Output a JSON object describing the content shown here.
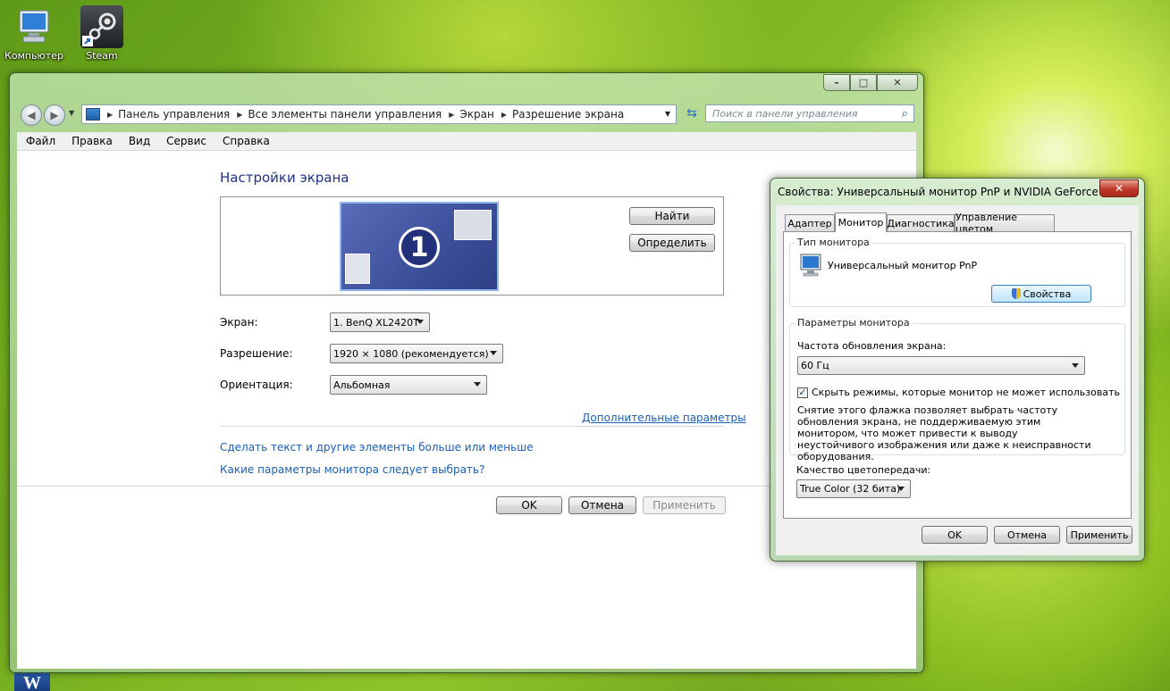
{
  "desktop": {
    "icons": [
      {
        "label": "Компьютер"
      },
      {
        "label": "Steam"
      }
    ]
  },
  "main_window": {
    "address_crumbs": [
      "Панель управления",
      "Все элементы панели управления",
      "Экран",
      "Разрешение экрана"
    ],
    "search_placeholder": "Поиск в панели управления",
    "menu": [
      "Файл",
      "Правка",
      "Вид",
      "Сервис",
      "Справка"
    ],
    "page_title": "Настройки экрана",
    "monitor_number": "1",
    "find_button": "Найти",
    "identify_button": "Определить",
    "display_label": "Экран:",
    "display_value": "1. BenQ XL2420T",
    "resolution_label": "Разрешение:",
    "resolution_value": "1920 × 1080 (рекомендуется)",
    "orientation_label": "Ориентация:",
    "orientation_value": "Альбомная",
    "advanced_link": "Дополнительные параметры",
    "text_size_link": "Сделать текст и другие элементы больше или меньше",
    "which_settings_link": "Какие параметры монитора следует выбрать?",
    "ok_button": "OK",
    "cancel_button": "Отмена",
    "apply_button": "Применить"
  },
  "properties_dialog": {
    "title": "Свойства: Универсальный монитор PnP и NVIDIA GeForce GTX ...",
    "tabs": [
      "Адаптер",
      "Монитор",
      "Диагностика",
      "Управление цветом"
    ],
    "active_tab": "Монитор",
    "monitor_type_group": "Тип монитора",
    "monitor_name": "Универсальный монитор PnP",
    "properties_button": "Свойства",
    "monitor_settings_group": "Параметры монитора",
    "refresh_label": "Частота обновления экрана:",
    "refresh_value": "60 Гц",
    "hide_modes_checked": true,
    "hide_modes_label": "Скрыть режимы, которые монитор не может использовать",
    "hide_modes_note": "Снятие этого флажка позволяет выбрать частоту обновления экрана, не поддерживаемую этим монитором, что может привести к выводу неустойчивого изображения или даже к неисправности оборудования.",
    "color_quality_label": "Качество цветопередачи:",
    "color_quality_value": "True Color (32 бита)",
    "ok_button": "OK",
    "cancel_button": "Отмена",
    "apply_button": "Применить"
  },
  "colors": {
    "link": "#1a5fb4",
    "monitor_preview": "#3c4f9a"
  }
}
